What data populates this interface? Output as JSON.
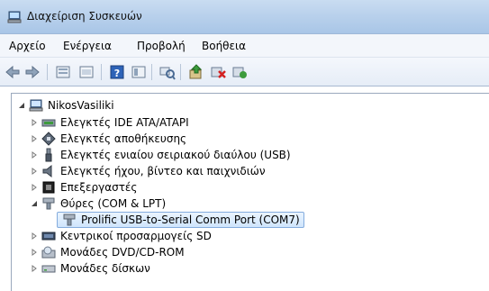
{
  "window": {
    "title": "Διαχείριση Συσκευών"
  },
  "menu": [
    "Αρχείο",
    "Ενέργεια",
    "Προβολή",
    "Βοήθεια"
  ],
  "tree": {
    "root": "NikosVasiliki",
    "nodes": [
      "Ελεγκτές IDE ATA/ATAPI",
      "Ελεγκτές αποθήκευσης",
      "Ελεγκτές ενιαίου σειριακού διαύλου (USB)",
      "Ελεγκτές ήχου, βίντεο και παιχνιδιών",
      "Επεξεργαστές",
      "Θύρες (COM & LPT)",
      "Prolific USB-to-Serial Comm Port (COM7)",
      "Κεντρικοί προσαρμογείς SD",
      "Μονάδες DVD/CD-ROM",
      "Μονάδες δίσκων"
    ]
  }
}
